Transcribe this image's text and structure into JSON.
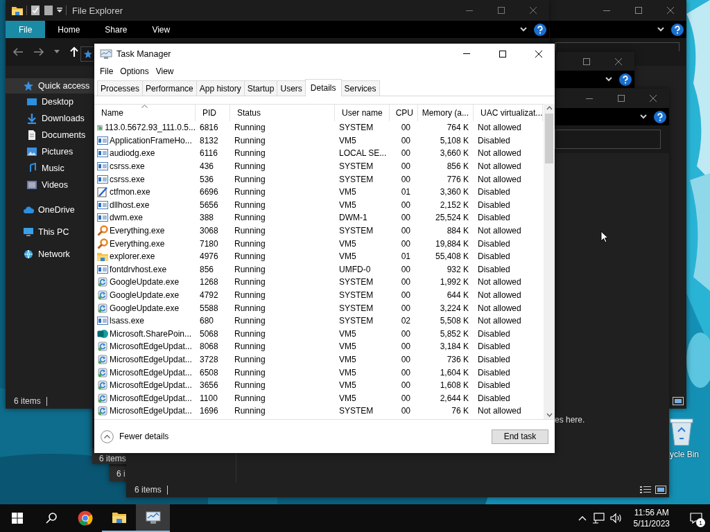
{
  "desktop": {
    "kind": "picture",
    "icons": [
      {
        "label": "ycle Bin"
      }
    ]
  },
  "background_windows": [
    {
      "status": "6 items"
    },
    {
      "status": "6 i"
    },
    {
      "status": "6 items",
      "content_text": "es here."
    }
  ],
  "file_explorer": {
    "title": "File Explorer",
    "ribbon_tabs": [
      {
        "label": "File",
        "kind": "menu"
      },
      {
        "label": "Home",
        "kind": "tab"
      },
      {
        "label": "Share",
        "kind": "tab"
      },
      {
        "label": "View",
        "kind": "tab"
      }
    ],
    "nav_items": [
      {
        "label": "Quick access",
        "kind": "star",
        "selected": true,
        "children": [
          {
            "label": "Desktop",
            "kind": "desktop",
            "selected": false
          },
          {
            "label": "Downloads",
            "kind": "download",
            "selected": false
          },
          {
            "label": "Documents",
            "kind": "document",
            "selected": false
          },
          {
            "label": "Pictures",
            "kind": "pictures",
            "selected": false
          },
          {
            "label": "Music",
            "kind": "music",
            "selected": false
          },
          {
            "label": "Videos",
            "kind": "video",
            "selected": false
          }
        ]
      },
      {
        "label": "OneDrive",
        "kind": "cloud",
        "selected": false
      },
      {
        "label": "This PC",
        "kind": "pc",
        "selected": false
      },
      {
        "label": "Network",
        "kind": "network",
        "selected": false
      }
    ],
    "status": "6 items"
  },
  "task_manager": {
    "title": "Task Manager",
    "menu": [
      "File",
      "Options",
      "View"
    ],
    "tabs": [
      {
        "label": "Processes",
        "selected": false
      },
      {
        "label": "Performance",
        "selected": false
      },
      {
        "label": "App history",
        "selected": false
      },
      {
        "label": "Startup",
        "selected": false
      },
      {
        "label": "Users",
        "selected": false
      },
      {
        "label": "Details",
        "selected": true
      },
      {
        "label": "Services",
        "selected": false
      }
    ],
    "columns": [
      {
        "label": "Name",
        "sorted": true
      },
      {
        "label": "PID",
        "sorted": false
      },
      {
        "label": "Status",
        "sorted": false
      },
      {
        "label": "User name",
        "sorted": false
      },
      {
        "label": "CPU",
        "sorted": false
      },
      {
        "label": "Memory (a...",
        "sorted": false
      },
      {
        "label": "UAC virtualizat...",
        "sorted": false
      }
    ],
    "rows": [
      {
        "kind": "installer",
        "name": "113.0.5672.93_111.0.5...",
        "pid": "6816",
        "status": "Running",
        "user": "SYSTEM",
        "cpu": "00",
        "memory": "764 K",
        "uac": "Not allowed",
        "selected": false
      },
      {
        "kind": "app",
        "name": "ApplicationFrameHo...",
        "pid": "8132",
        "status": "Running",
        "user": "VM5",
        "cpu": "00",
        "memory": "5,108 K",
        "uac": "Disabled",
        "selected": false
      },
      {
        "kind": "app",
        "name": "audiodg.exe",
        "pid": "6116",
        "status": "Running",
        "user": "LOCAL SE...",
        "cpu": "00",
        "memory": "3,660 K",
        "uac": "Not allowed",
        "selected": false
      },
      {
        "kind": "app",
        "name": "csrss.exe",
        "pid": "436",
        "status": "Running",
        "user": "SYSTEM",
        "cpu": "00",
        "memory": "856 K",
        "uac": "Not allowed",
        "selected": false
      },
      {
        "kind": "app",
        "name": "csrss.exe",
        "pid": "536",
        "status": "Running",
        "user": "SYSTEM",
        "cpu": "00",
        "memory": "776 K",
        "uac": "Not allowed",
        "selected": false
      },
      {
        "kind": "pen",
        "name": "ctfmon.exe",
        "pid": "6696",
        "status": "Running",
        "user": "VM5",
        "cpu": "01",
        "memory": "3,360 K",
        "uac": "Disabled",
        "selected": false
      },
      {
        "kind": "app",
        "name": "dllhost.exe",
        "pid": "5656",
        "status": "Running",
        "user": "VM5",
        "cpu": "00",
        "memory": "2,152 K",
        "uac": "Disabled",
        "selected": false
      },
      {
        "kind": "app",
        "name": "dwm.exe",
        "pid": "388",
        "status": "Running",
        "user": "DWM-1",
        "cpu": "00",
        "memory": "25,524 K",
        "uac": "Disabled",
        "selected": false
      },
      {
        "kind": "magnifier",
        "name": "Everything.exe",
        "pid": "3068",
        "status": "Running",
        "user": "SYSTEM",
        "cpu": "00",
        "memory": "884 K",
        "uac": "Not allowed",
        "selected": false
      },
      {
        "kind": "magnifier",
        "name": "Everything.exe",
        "pid": "7180",
        "status": "Running",
        "user": "VM5",
        "cpu": "00",
        "memory": "19,884 K",
        "uac": "Disabled",
        "selected": false
      },
      {
        "kind": "folder",
        "name": "explorer.exe",
        "pid": "4976",
        "status": "Running",
        "user": "VM5",
        "cpu": "01",
        "memory": "55,408 K",
        "uac": "Disabled",
        "selected": false
      },
      {
        "kind": "app",
        "name": "fontdrvhost.exe",
        "pid": "856",
        "status": "Running",
        "user": "UMFD-0",
        "cpu": "00",
        "memory": "932 K",
        "uac": "Disabled",
        "selected": false
      },
      {
        "kind": "update",
        "name": "GoogleUpdate.exe",
        "pid": "1268",
        "status": "Running",
        "user": "SYSTEM",
        "cpu": "00",
        "memory": "1,992 K",
        "uac": "Not allowed",
        "selected": false
      },
      {
        "kind": "update",
        "name": "GoogleUpdate.exe",
        "pid": "4792",
        "status": "Running",
        "user": "SYSTEM",
        "cpu": "00",
        "memory": "644 K",
        "uac": "Not allowed",
        "selected": false
      },
      {
        "kind": "update",
        "name": "GoogleUpdate.exe",
        "pid": "5588",
        "status": "Running",
        "user": "SYSTEM",
        "cpu": "00",
        "memory": "3,224 K",
        "uac": "Not allowed",
        "selected": false
      },
      {
        "kind": "app",
        "name": "lsass.exe",
        "pid": "680",
        "status": "Running",
        "user": "SYSTEM",
        "cpu": "02",
        "memory": "5,508 K",
        "uac": "Not allowed",
        "selected": false
      },
      {
        "kind": "badge",
        "name": "Microsoft.SharePoin...",
        "pid": "5068",
        "status": "Running",
        "user": "VM5",
        "cpu": "00",
        "memory": "5,852 K",
        "uac": "Disabled",
        "selected": false
      },
      {
        "kind": "update",
        "name": "MicrosoftEdgeUpdat...",
        "pid": "8068",
        "status": "Running",
        "user": "VM5",
        "cpu": "00",
        "memory": "3,184 K",
        "uac": "Disabled",
        "selected": false
      },
      {
        "kind": "update",
        "name": "MicrosoftEdgeUpdat...",
        "pid": "3728",
        "status": "Running",
        "user": "VM5",
        "cpu": "00",
        "memory": "736 K",
        "uac": "Disabled",
        "selected": false
      },
      {
        "kind": "update",
        "name": "MicrosoftEdgeUpdat...",
        "pid": "6508",
        "status": "Running",
        "user": "VM5",
        "cpu": "00",
        "memory": "1,604 K",
        "uac": "Disabled",
        "selected": false
      },
      {
        "kind": "update",
        "name": "MicrosoftEdgeUpdat...",
        "pid": "3656",
        "status": "Running",
        "user": "VM5",
        "cpu": "00",
        "memory": "1,608 K",
        "uac": "Disabled",
        "selected": false
      },
      {
        "kind": "update",
        "name": "MicrosoftEdgeUpdat...",
        "pid": "1100",
        "status": "Running",
        "user": "VM5",
        "cpu": "00",
        "memory": "2,644 K",
        "uac": "Disabled",
        "selected": false
      },
      {
        "kind": "update",
        "name": "MicrosoftEdgeUpdat...",
        "pid": "1696",
        "status": "Running",
        "user": "SYSTEM",
        "cpu": "00",
        "memory": "76 K",
        "uac": "Not allowed",
        "selected": false
      }
    ],
    "footer": {
      "toggle": "Fewer details",
      "button": "End task"
    }
  },
  "taskbar": {
    "apps": [
      {
        "kind": "chrome",
        "running": false,
        "active": false
      },
      {
        "kind": "explorer",
        "running": true,
        "active": false
      },
      {
        "kind": "taskmanager",
        "running": true,
        "active": true
      }
    ],
    "tray": {
      "time": "11:56 AM",
      "date": "5/11/2023",
      "notifications": "1"
    }
  }
}
